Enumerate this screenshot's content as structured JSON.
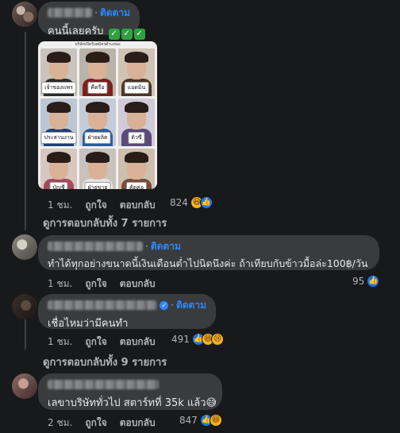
{
  "comments": [
    {
      "follow": "ติดตาม",
      "text": "คนนี้เลยครับ",
      "emoji": [
        "✓",
        "✓",
        "✓"
      ],
      "time": "1 ชม.",
      "like": "ถูกใจ",
      "reply": "ตอบกลับ",
      "reaction_count": "824",
      "reactions": [
        "haha-icon",
        "like-icon"
      ]
    },
    {
      "follow": "ติดตาม",
      "text": "ทำได้ทุกอย่างขนาดนี้เงินเดือนต่ำไปนิดนึงค่ะ ถ้าเทียบกับข้าวมื้อล่ะ100฿/วัน",
      "time": "1 ชม.",
      "like": "ถูกใจ",
      "reply": "ตอบกลับ",
      "reaction_count": "95",
      "reactions": [
        "like-icon"
      ]
    },
    {
      "follow": "ติดตาม",
      "text": "เชื่อไหมว่ามีคนทำ",
      "time": "1 ชม.",
      "like": "ถูกใจ",
      "reply": "ตอบกลับ",
      "reaction_count": "491",
      "reactions": [
        "like-icon",
        "haha-icon",
        "sad-icon"
      ]
    },
    {
      "text": "เลขาบริษัททั่วไป สตาร์ทที่ 35k แล้ว😅",
      "time": "2 ชม.",
      "like": "ถูกใจ",
      "reply": "ตอบกลับ",
      "reaction_count": "847",
      "reactions": [
        "like-icon",
        "haha-icon"
      ]
    }
  ],
  "view_replies": [
    "ดูการตอบกลับทั้ง 7 รายการ",
    "ดูการตอบกลับทั้ง 9 รายการ"
  ],
  "image": {
    "header": "บริษัทเปิดรับสมัครตำแหน่ง",
    "cells": [
      {
        "label": "เจ้าของแพร",
        "shirt": "#2b2b2b",
        "bg": "#c9c4bd"
      },
      {
        "label": "คีดรือ",
        "shirt": "#7d1f1f",
        "bg": "#b9b3aa"
      },
      {
        "label": "แอดมิน",
        "shirt": "#4a3526",
        "bg": "#cfc4b3"
      },
      {
        "label": "ประสานงาน",
        "shirt": "#1e3f73",
        "bg": "#bcc7d3"
      },
      {
        "label": "ฝ่ายผลิต",
        "shirt": "#2a5c9a",
        "bg": "#c4ccd8"
      },
      {
        "label": "ติวซี",
        "shirt": "#5a4b7a",
        "bg": "#d1cbd8"
      },
      {
        "label": "บัญชี",
        "shirt": "#a3485e",
        "bg": "#d6c7bf"
      },
      {
        "label": "ฝ่ายขาย",
        "shirt": "#e4e4e4",
        "bg": "#c7c2bb"
      },
      {
        "label": "คัดค่อ",
        "shirt": "#7a4a3a",
        "bg": "#cdbfae"
      }
    ]
  }
}
